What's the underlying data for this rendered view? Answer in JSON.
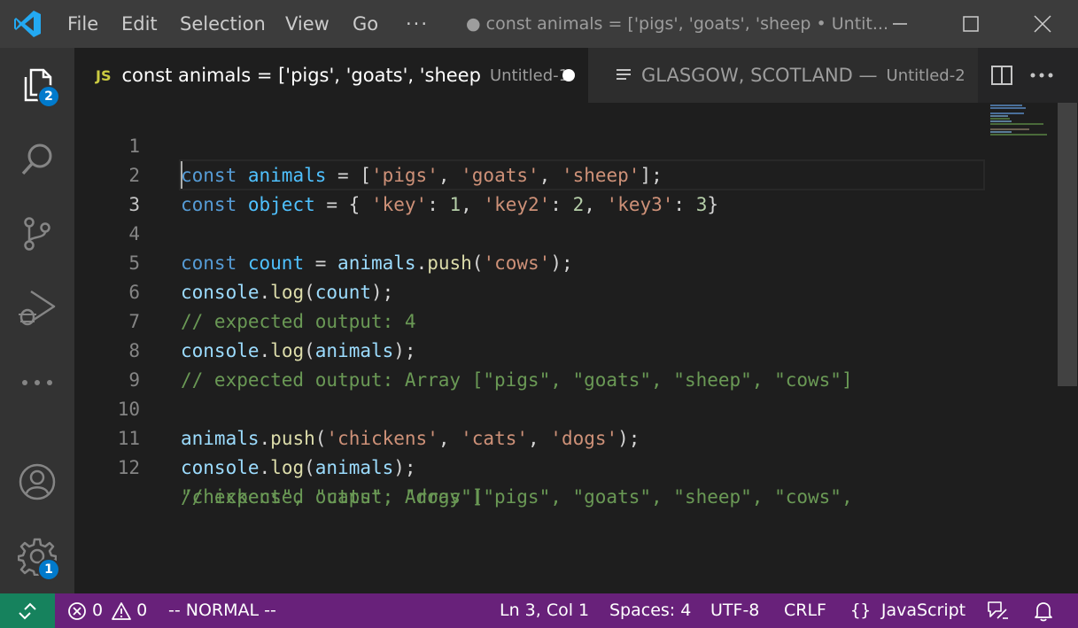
{
  "menu": {
    "file": "File",
    "edit": "Edit",
    "selection": "Selection",
    "view": "View",
    "go": "Go",
    "more": "···"
  },
  "window": {
    "title": "● const animals = ['pigs', 'goats', 'sheep • Untit..."
  },
  "activity": {
    "explorer_badge": "2",
    "settings_badge": "1"
  },
  "tabs": [
    {
      "icon": "JS",
      "title": "const animals = ['pigs', 'goats', 'sheep",
      "description": "Untitled-1"
    },
    {
      "title": "GLASGOW, SCOTLAND —",
      "description": "Untitled-2"
    }
  ],
  "editor": {
    "line_numbers": [
      "1",
      "2",
      "3",
      "4",
      "5",
      "6",
      "7",
      "8",
      "9",
      "10",
      "11",
      "12"
    ],
    "current_line": 3
  },
  "status": {
    "errors": "0",
    "warnings": "0",
    "mode": "-- NORMAL --",
    "position": "Ln 3, Col 1",
    "spaces": "Spaces: 4",
    "encoding": "UTF-8",
    "eol": "CRLF",
    "language": "JavaScript"
  },
  "colors": {
    "statusbar": "#68217a",
    "remote": "#16825d",
    "badge": "#007acc",
    "keyword": "#569cd6",
    "string": "#ce9178",
    "comment": "#6a9955"
  }
}
